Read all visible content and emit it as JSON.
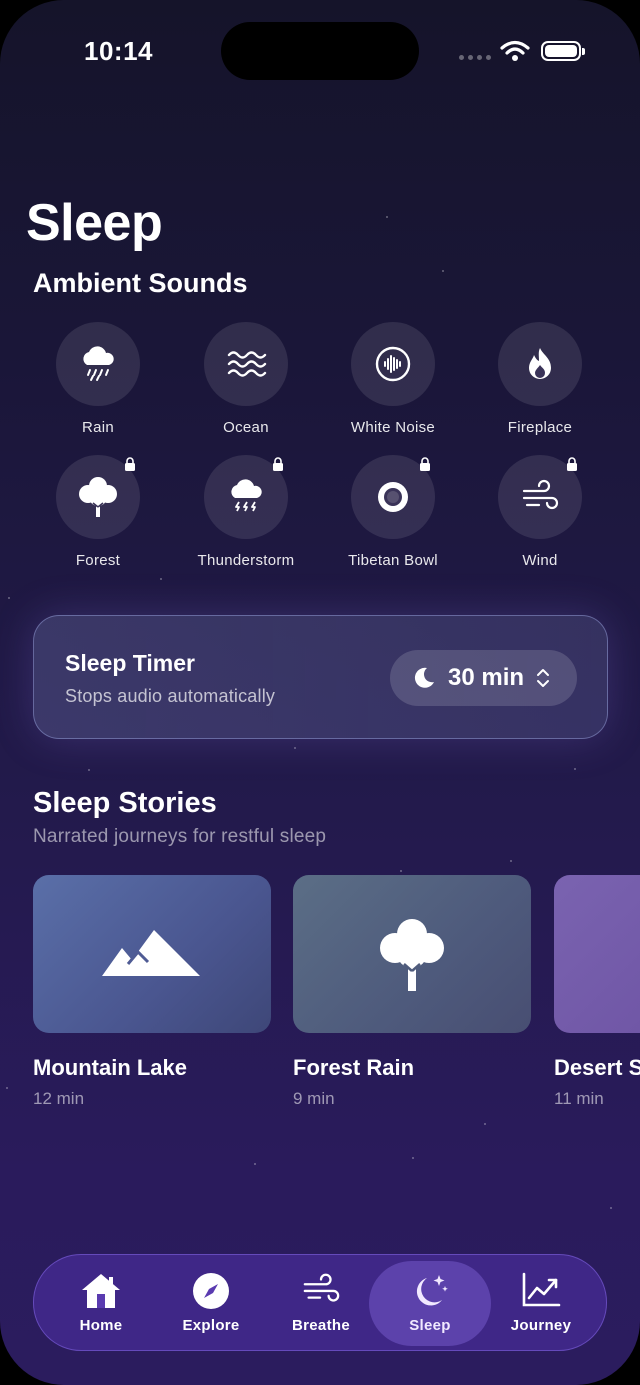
{
  "status_bar": {
    "time": "10:14"
  },
  "page": {
    "title": "Sleep"
  },
  "ambient": {
    "title": "Ambient Sounds",
    "items": [
      {
        "label": "Rain",
        "icon": "rain-cloud-icon",
        "locked": false
      },
      {
        "label": "Ocean",
        "icon": "waves-icon",
        "locked": false
      },
      {
        "label": "White Noise",
        "icon": "waveform-icon",
        "locked": false
      },
      {
        "label": "Fireplace",
        "icon": "flame-icon",
        "locked": false
      },
      {
        "label": "Forest",
        "icon": "tree-icon",
        "locked": true
      },
      {
        "label": "Thunderstorm",
        "icon": "storm-cloud-icon",
        "locked": true
      },
      {
        "label": "Tibetan Bowl",
        "icon": "bowl-icon",
        "locked": true
      },
      {
        "label": "Wind",
        "icon": "wind-icon",
        "locked": true
      }
    ]
  },
  "timer": {
    "title": "Sleep Timer",
    "subtitle": "Stops audio automatically",
    "value": "30 min"
  },
  "stories": {
    "title": "Sleep Stories",
    "subtitle": "Narrated journeys for restful sleep",
    "items": [
      {
        "title": "Mountain Lake",
        "duration": "12 min",
        "icon": "mountains-icon"
      },
      {
        "title": "Forest Rain",
        "duration": "9 min",
        "icon": "tree-icon"
      },
      {
        "title": "Desert Stars",
        "duration": "11 min",
        "icon": ""
      }
    ]
  },
  "tabs": [
    {
      "label": "Home",
      "icon": "house-icon"
    },
    {
      "label": "Explore",
      "icon": "compass-icon"
    },
    {
      "label": "Breathe",
      "icon": "wind-icon"
    },
    {
      "label": "Sleep",
      "icon": "moon-stars-icon",
      "active": true
    },
    {
      "label": "Journey",
      "icon": "chart-up-icon"
    }
  ]
}
